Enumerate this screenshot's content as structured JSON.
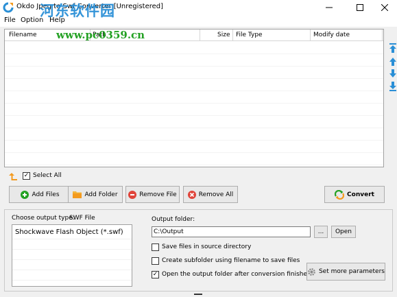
{
  "window": {
    "title": "Okdo Jpeg to Swf Converter [Unregistered]",
    "watermark_text": "河东软件园",
    "watermark_url": "www.pc0359.cn"
  },
  "menu": [
    "File",
    "Option",
    "Help"
  ],
  "file_list": {
    "columns": [
      "Filename",
      "Path",
      "Size",
      "File Type",
      "Modify date"
    ],
    "rows": []
  },
  "select_all": {
    "label": "Select All",
    "checked": true
  },
  "buttons": {
    "add_files": "Add Files",
    "add_folder": "Add Folder",
    "remove_file": "Remove File",
    "remove_all": "Remove All",
    "convert": "Convert",
    "browse": "...",
    "open": "Open",
    "set_more_parameters": "Set more parameters"
  },
  "output_type": {
    "label": "Choose output type:",
    "selected": "SWF File",
    "options": [
      "Shockwave Flash Object (*.swf)"
    ]
  },
  "output_folder": {
    "label": "Output folder:",
    "value": "C:\\Output"
  },
  "options": {
    "save_in_source": {
      "label": "Save files in source directory",
      "checked": false
    },
    "create_subfolder": {
      "label": "Create subfolder using filename to save files",
      "checked": false
    },
    "open_after": {
      "label": "Open the output folder after conversion finished",
      "checked": true
    }
  },
  "colors": {
    "accent_blue": "#2a8fd6",
    "green": "#23a123",
    "orange": "#f39a1e",
    "red": "#e0443a"
  }
}
